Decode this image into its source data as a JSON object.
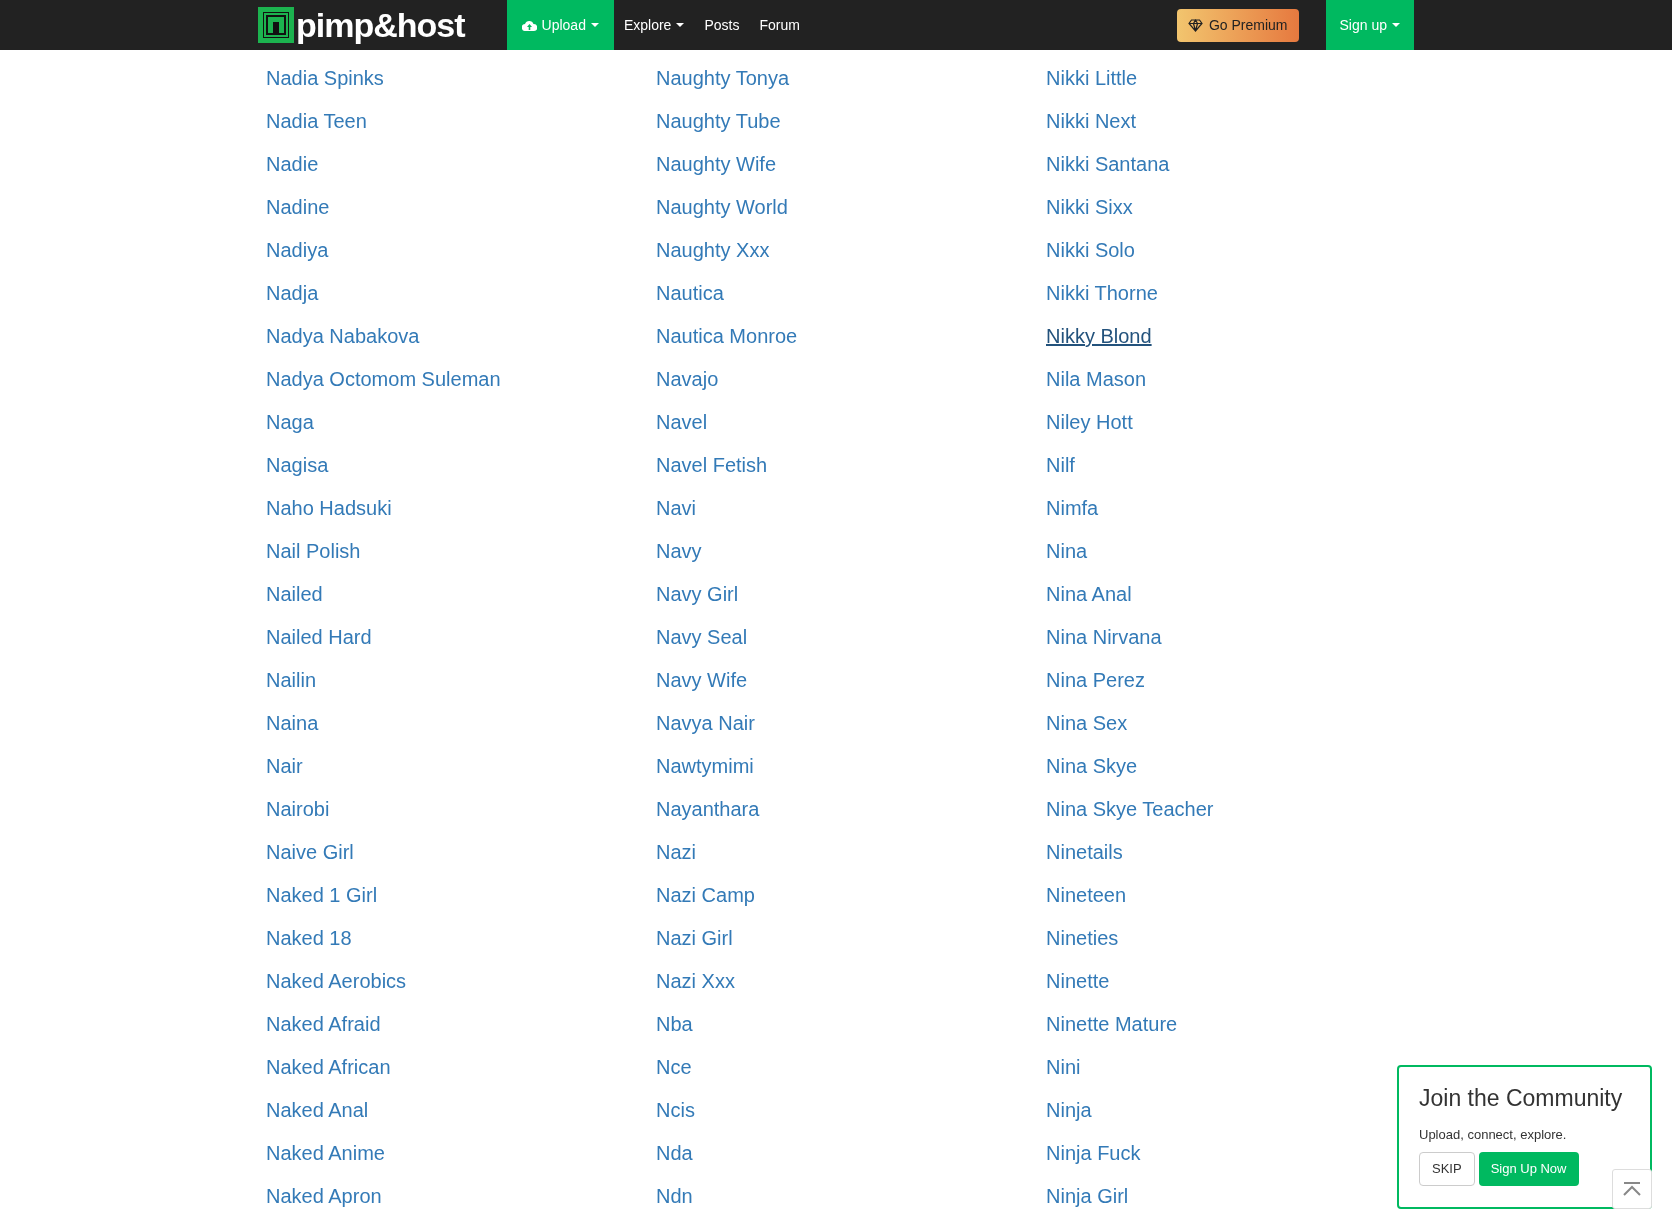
{
  "navbar": {
    "logo": "pimp&host",
    "menu": [
      {
        "label": "Upload",
        "kind": "upload",
        "selected": true
      },
      {
        "label": "Explore",
        "kind": "dropdown",
        "selected": false
      },
      {
        "label": "Posts",
        "kind": "link",
        "selected": false
      },
      {
        "label": "Forum",
        "kind": "link",
        "selected": false
      }
    ],
    "premium": "Go Premium",
    "signup": "Sign up"
  },
  "tag_columns": [
    [
      {
        "label": "Nadia Spinks",
        "hovered": false
      },
      {
        "label": "Nadia Teen",
        "hovered": false
      },
      {
        "label": "Nadie",
        "hovered": false
      },
      {
        "label": "Nadine",
        "hovered": false
      },
      {
        "label": "Nadiya",
        "hovered": false
      },
      {
        "label": "Nadja",
        "hovered": false
      },
      {
        "label": "Nadya Nabakova",
        "hovered": false
      },
      {
        "label": "Nadya Octomom Suleman",
        "hovered": false
      },
      {
        "label": "Naga",
        "hovered": false
      },
      {
        "label": "Nagisa",
        "hovered": false
      },
      {
        "label": "Naho Hadsuki",
        "hovered": false
      },
      {
        "label": "Nail Polish",
        "hovered": false
      },
      {
        "label": "Nailed",
        "hovered": false
      },
      {
        "label": "Nailed Hard",
        "hovered": false
      },
      {
        "label": "Nailin",
        "hovered": false
      },
      {
        "label": "Naina",
        "hovered": false
      },
      {
        "label": "Nair",
        "hovered": false
      },
      {
        "label": "Nairobi",
        "hovered": false
      },
      {
        "label": "Naive Girl",
        "hovered": false
      },
      {
        "label": "Naked 1 Girl",
        "hovered": false
      },
      {
        "label": "Naked 18",
        "hovered": false
      },
      {
        "label": "Naked Aerobics",
        "hovered": false
      },
      {
        "label": "Naked Afraid",
        "hovered": false
      },
      {
        "label": "Naked African",
        "hovered": false
      },
      {
        "label": "Naked Anal",
        "hovered": false
      },
      {
        "label": "Naked Anime",
        "hovered": false
      },
      {
        "label": "Naked Apron",
        "hovered": false
      }
    ],
    [
      {
        "label": "Naughty Tonya",
        "hovered": false
      },
      {
        "label": "Naughty Tube",
        "hovered": false
      },
      {
        "label": "Naughty Wife",
        "hovered": false
      },
      {
        "label": "Naughty World",
        "hovered": false
      },
      {
        "label": "Naughty Xxx",
        "hovered": false
      },
      {
        "label": "Nautica",
        "hovered": false
      },
      {
        "label": "Nautica Monroe",
        "hovered": false
      },
      {
        "label": "Navajo",
        "hovered": false
      },
      {
        "label": "Navel",
        "hovered": false
      },
      {
        "label": "Navel Fetish",
        "hovered": false
      },
      {
        "label": "Navi",
        "hovered": false
      },
      {
        "label": "Navy",
        "hovered": false
      },
      {
        "label": "Navy Girl",
        "hovered": false
      },
      {
        "label": "Navy Seal",
        "hovered": false
      },
      {
        "label": "Navy Wife",
        "hovered": false
      },
      {
        "label": "Navya Nair",
        "hovered": false
      },
      {
        "label": "Nawtymimi",
        "hovered": false
      },
      {
        "label": "Nayanthara",
        "hovered": false
      },
      {
        "label": "Nazi",
        "hovered": false
      },
      {
        "label": "Nazi Camp",
        "hovered": false
      },
      {
        "label": "Nazi Girl",
        "hovered": false
      },
      {
        "label": "Nazi Xxx",
        "hovered": false
      },
      {
        "label": "Nba",
        "hovered": false
      },
      {
        "label": "Nce",
        "hovered": false
      },
      {
        "label": "Ncis",
        "hovered": false
      },
      {
        "label": "Nda",
        "hovered": false
      },
      {
        "label": "Ndn",
        "hovered": false
      }
    ],
    [
      {
        "label": "Nikki Little",
        "hovered": false
      },
      {
        "label": "Nikki Next",
        "hovered": false
      },
      {
        "label": "Nikki Santana",
        "hovered": false
      },
      {
        "label": "Nikki Sixx",
        "hovered": false
      },
      {
        "label": "Nikki Solo",
        "hovered": false
      },
      {
        "label": "Nikki Thorne",
        "hovered": false
      },
      {
        "label": "Nikky Blond",
        "hovered": true
      },
      {
        "label": "Nila Mason",
        "hovered": false
      },
      {
        "label": "Niley Hott",
        "hovered": false
      },
      {
        "label": "Nilf",
        "hovered": false
      },
      {
        "label": "Nimfa",
        "hovered": false
      },
      {
        "label": "Nina",
        "hovered": false
      },
      {
        "label": "Nina Anal",
        "hovered": false
      },
      {
        "label": "Nina Nirvana",
        "hovered": false
      },
      {
        "label": "Nina Perez",
        "hovered": false
      },
      {
        "label": "Nina Sex",
        "hovered": false
      },
      {
        "label": "Nina Skye",
        "hovered": false
      },
      {
        "label": "Nina Skye Teacher",
        "hovered": false
      },
      {
        "label": "Ninetails",
        "hovered": false
      },
      {
        "label": "Nineteen",
        "hovered": false
      },
      {
        "label": "Nineties",
        "hovered": false
      },
      {
        "label": "Ninette",
        "hovered": false
      },
      {
        "label": "Ninette Mature",
        "hovered": false
      },
      {
        "label": "Nini",
        "hovered": false
      },
      {
        "label": "Ninja",
        "hovered": false
      },
      {
        "label": "Ninja Fuck",
        "hovered": false
      },
      {
        "label": "Ninja Girl",
        "hovered": false
      }
    ]
  ],
  "popup": {
    "title": "Join the Community",
    "text": "Upload, connect, explore.",
    "skip": "SKIP",
    "signup": "Sign Up Now"
  }
}
